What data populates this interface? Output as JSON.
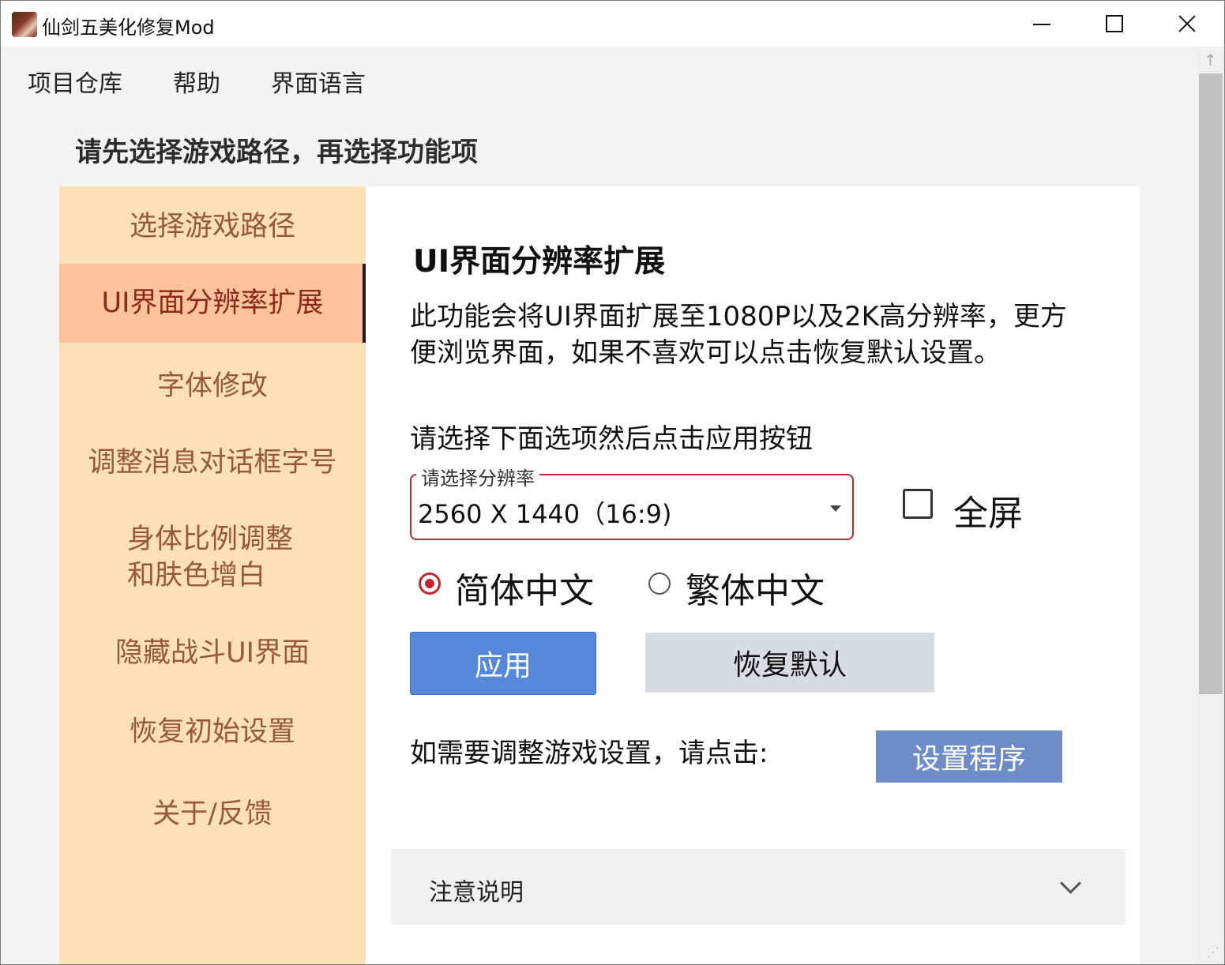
{
  "window": {
    "title": "仙剑五美化修复Mod",
    "icon": "app-icon",
    "controls": {
      "minimize": "minimize-icon",
      "maximize": "maximize-icon",
      "close": "close-icon"
    }
  },
  "menu": {
    "items": [
      {
        "label": "项目仓库"
      },
      {
        "label": "帮助"
      },
      {
        "label": "界面语言"
      }
    ]
  },
  "instruction": "请先选择游戏路径，再选择功能项",
  "sidebar": {
    "items": [
      {
        "label": "选择游戏路径",
        "active": false
      },
      {
        "label": "UI界面分辨率扩展",
        "active": true
      },
      {
        "label": "字体修改",
        "active": false
      },
      {
        "label": "调整消息对话框字号",
        "active": false
      },
      {
        "label_line1": "身体比例调整",
        "label_line2": "和肤色增白",
        "active": false
      },
      {
        "label": "隐藏战斗UI界面",
        "active": false
      },
      {
        "label": "恢复初始设置",
        "active": false
      },
      {
        "label": "关于/反馈",
        "active": false
      }
    ]
  },
  "main": {
    "title": "UI界面分辨率扩展",
    "description_line1": "此功能会将UI界面扩展至1080P以及2K高分辨率，更方",
    "description_line2": "便浏览界面，如果不喜欢可以点击恢复默认设置。",
    "prompt": "请选择下面选项然后点击应用按钮",
    "resolution_select": {
      "legend": "请选择分辨率",
      "value": "2560 X 1440（16:9)"
    },
    "fullscreen": {
      "label": "全屏",
      "checked": false
    },
    "language_radios": [
      {
        "label": "简体中文",
        "selected": true
      },
      {
        "label": "繁体中文",
        "selected": false
      }
    ],
    "apply_label": "应用",
    "restore_label": "恢复默认",
    "settings_prompt": "如需要调整游戏设置，请点击:",
    "settings_button": "设置程序",
    "accordion": {
      "title": "注意说明",
      "expanded": false
    }
  },
  "colors": {
    "sidebar_bg": "#fde0b3",
    "sidebar_active_bg": "#ffc39b",
    "sidebar_text": "#96593a",
    "sidebar_active_text": "#8c2a1a",
    "accent_red": "#c2262f",
    "apply_blue": "#5588d9",
    "settings_blue": "#6e8cc8",
    "restore_gray": "#d8dbe0"
  }
}
